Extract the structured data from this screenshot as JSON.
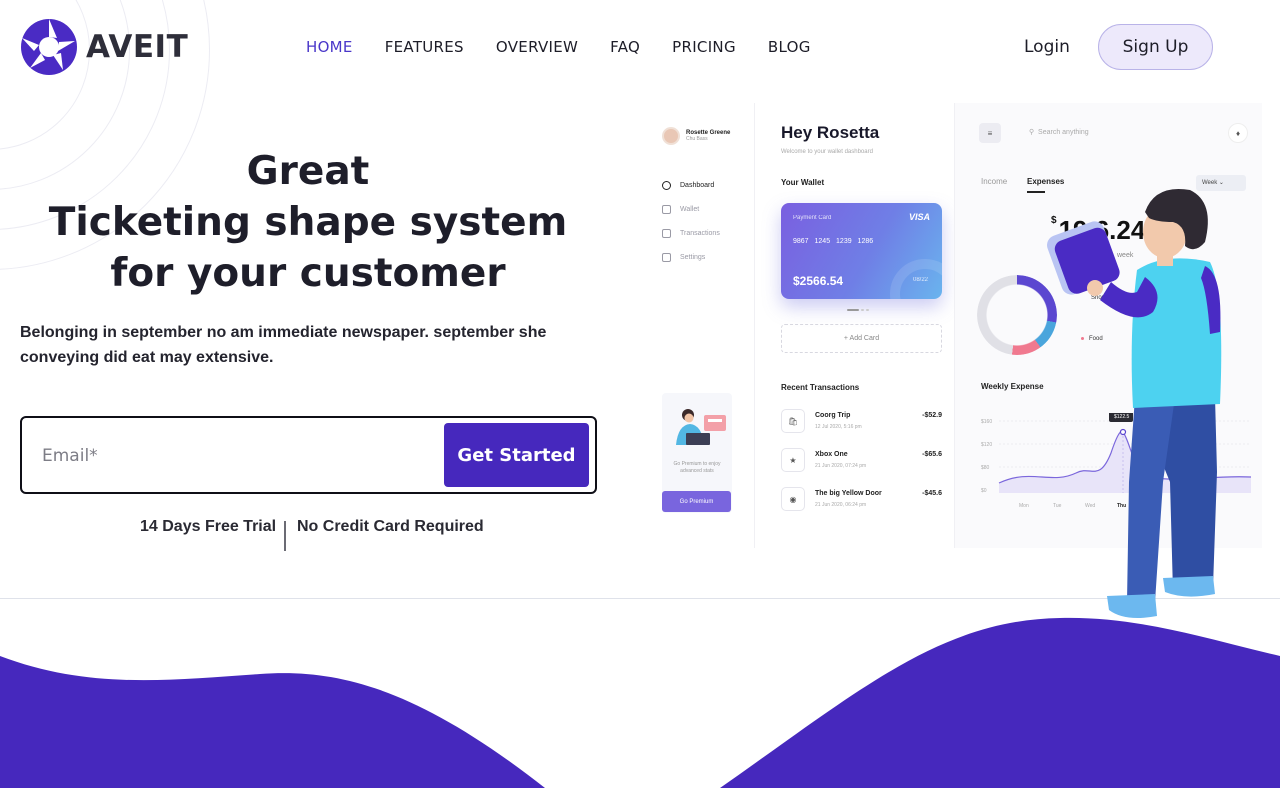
{
  "brand": {
    "name": "AVEIT",
    "accent": "#4628bd"
  },
  "nav": {
    "items": [
      {
        "label": "HOME",
        "active": true
      },
      {
        "label": "FEATURES",
        "active": false
      },
      {
        "label": "OVERVIEW",
        "active": false
      },
      {
        "label": "FAQ",
        "active": false
      },
      {
        "label": "PRICING",
        "active": false
      },
      {
        "label": "BLOG",
        "active": false
      }
    ],
    "login": "Login",
    "signup": "Sign Up"
  },
  "hero": {
    "title_line1": "Great",
    "title_line2": "Ticketing shape system",
    "title_line3": "for your customer",
    "subtitle": "Belonging in september no am immediate newspaper. september she conveying did eat may extensive.",
    "email_placeholder": "Email*",
    "cta": "Get Started",
    "trial": "14 Days Free Trial",
    "no_card": "No Credit Card Required"
  },
  "dashboard": {
    "user_name": "Rosette Greene",
    "user_sub": "Chu Bass",
    "sidebar": [
      "Dashboard",
      "Wallet",
      "Transactions",
      "Settings"
    ],
    "promo_text": "Go Premium to enjoy advanced stats",
    "promo_button": "Go Premium",
    "greeting": "Hey Rosetta",
    "welcome": "Welcome to your wallet dashboard",
    "wallet_title": "Your Wallet",
    "card": {
      "label": "Payment Card",
      "brand": "VISA",
      "number": "9867 1245 1239 1286",
      "balance": "$2566.54",
      "expiry": "08/22"
    },
    "add_card": "+ Add Card",
    "recent_title": "Recent Transactions",
    "transactions": [
      {
        "name": "Coorg Trip",
        "date": "12 Jul 2020, 5:16 pm",
        "amount": "-$52.9"
      },
      {
        "name": "Xbox One",
        "date": "21 Jun 2020, 07:24 pm",
        "amount": "-$65.6"
      },
      {
        "name": "The big Yellow Door",
        "date": "21 Jun 2020, 06:24 pm",
        "amount": "-$45.6"
      }
    ],
    "search_placeholder": "Search anything",
    "tab_income": "Income",
    "tab_expenses": "Expenses",
    "period": "Week",
    "amount_currency": "$",
    "amount_visible": "19 6.24",
    "per_week": "week",
    "legend_shopping": "Shoppi",
    "legend_food": "Food",
    "weekly_title": "Weekly Expense",
    "y_ticks": [
      "$160",
      "$120",
      "$80",
      "$0"
    ],
    "tooltip": "$122.5",
    "x_days": [
      "Mon",
      "Tue",
      "Wed",
      "Thu"
    ]
  }
}
